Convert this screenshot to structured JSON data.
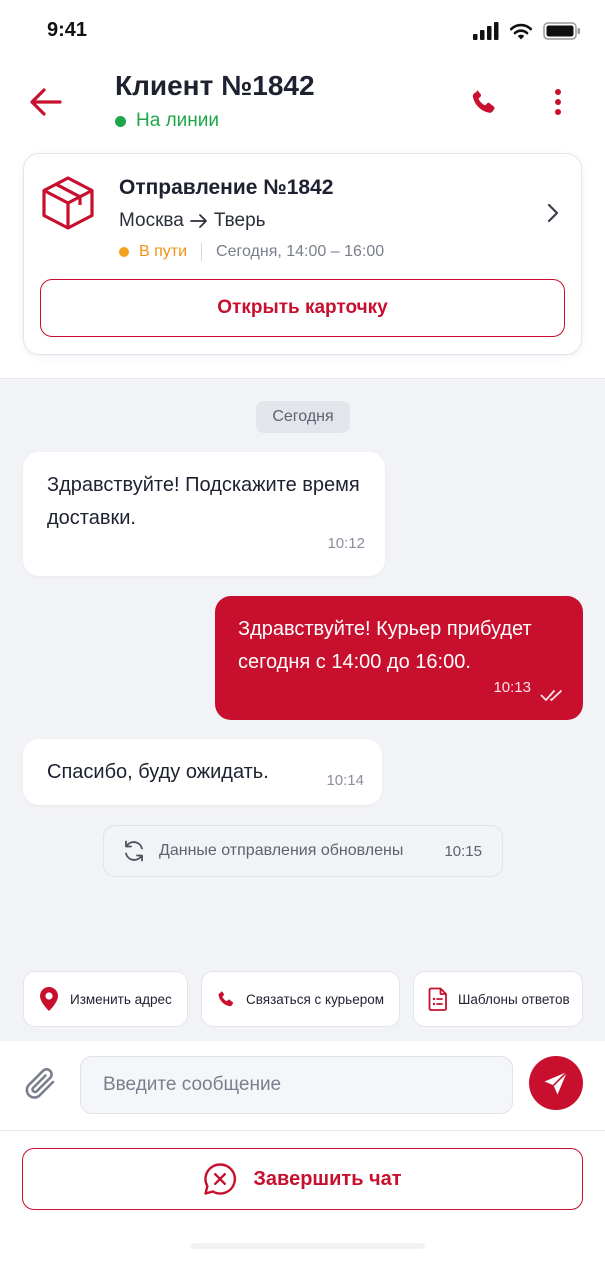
{
  "status_bar": {
    "time": "9:41"
  },
  "header": {
    "title": "Клиент №1842",
    "presence": "На линии",
    "presence_color": "#1fa64a",
    "icons": [
      "arrow-left-icon",
      "phone-icon",
      "more-vertical-icon"
    ]
  },
  "shipment": {
    "title": "Отправление №1842",
    "from": "Москва",
    "to": "Тверь",
    "status": "В пути",
    "status_color": "#f4a21b",
    "time_window": "Сегодня, 14:00 – 16:00",
    "open_card_label": "Открыть карточку",
    "icons": [
      "box-icon",
      "chevron-right-icon"
    ]
  },
  "chat": {
    "date_label": "Сегодня",
    "messages": [
      {
        "direction": "incoming",
        "text": "Здравствуйте! Подскажите время доставки.",
        "time": "10:12"
      },
      {
        "direction": "outgoing",
        "text": "Здравствуйте! Курьер прибудет сегодня с 14:00 до 16:00.",
        "time": "10:13",
        "read": true
      },
      {
        "direction": "incoming",
        "text": "Спасибо, буду ожидать.",
        "time": "10:14"
      }
    ],
    "system_note": {
      "text": "Данные отправления обновлены",
      "time": "10:15",
      "icon": "refresh-icon"
    }
  },
  "quick_actions": [
    {
      "label": "Изменить адрес",
      "icon": "location-pin-icon"
    },
    {
      "label": "Связаться с курьером",
      "icon": "phone-icon"
    },
    {
      "label": "Шаблоны ответов",
      "icon": "document-list-icon"
    }
  ],
  "composer": {
    "value": "",
    "placeholder": "Введите сообщение",
    "icons": [
      "paperclip-icon",
      "send-icon"
    ]
  },
  "end_chat": {
    "label": "Завершить чат",
    "icon": "chat-close-icon"
  },
  "colors": {
    "accent": "#c8102e",
    "chat_background": "#f2f3f7"
  }
}
